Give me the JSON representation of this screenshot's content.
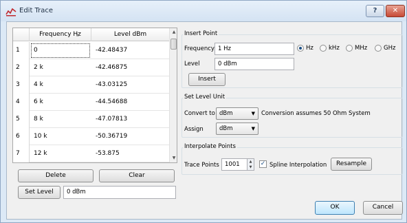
{
  "window": {
    "title": "Edit Trace",
    "help_label": "?",
    "close_label": "✕"
  },
  "table": {
    "columns": [
      "",
      "Frequency Hz",
      "Level dBm"
    ],
    "rows": [
      {
        "index": "1",
        "frequency": "0",
        "level": "-42.48437"
      },
      {
        "index": "2",
        "frequency": "2 k",
        "level": "-42.46875"
      },
      {
        "index": "3",
        "frequency": "4 k",
        "level": "-43.03125"
      },
      {
        "index": "4",
        "frequency": "6 k",
        "level": "-44.54688"
      },
      {
        "index": "5",
        "frequency": "8 k",
        "level": "-47.07813"
      },
      {
        "index": "6",
        "frequency": "10 k",
        "level": "-50.36719"
      },
      {
        "index": "7",
        "frequency": "12 k",
        "level": "-53.875"
      }
    ]
  },
  "left_buttons": {
    "delete": "Delete",
    "clear": "Clear",
    "set_level": "Set Level",
    "set_level_value": "0 dBm"
  },
  "insert_point": {
    "title": "Insert Point",
    "frequency_label": "Frequency",
    "frequency_value": "1 Hz",
    "units": [
      "Hz",
      "kHz",
      "MHz",
      "GHz"
    ],
    "selected_unit": "Hz",
    "level_label": "Level",
    "level_value": "0 dBm",
    "insert_label": "Insert"
  },
  "set_level_unit": {
    "title": "Set Level Unit",
    "convert_label": "Convert to",
    "convert_value": "dBm",
    "note": "Conversion assumes 50 Ohm System",
    "assign_label": "Assign",
    "assign_value": "dBm"
  },
  "interpolate": {
    "title": "Interpolate Points",
    "trace_points_label": "Trace Points",
    "trace_points_value": "1001",
    "spline_label": "Spline Interpolation",
    "spline_checked": true,
    "resample_label": "Resample"
  },
  "dialog_buttons": {
    "ok": "OK",
    "cancel": "Cancel"
  }
}
